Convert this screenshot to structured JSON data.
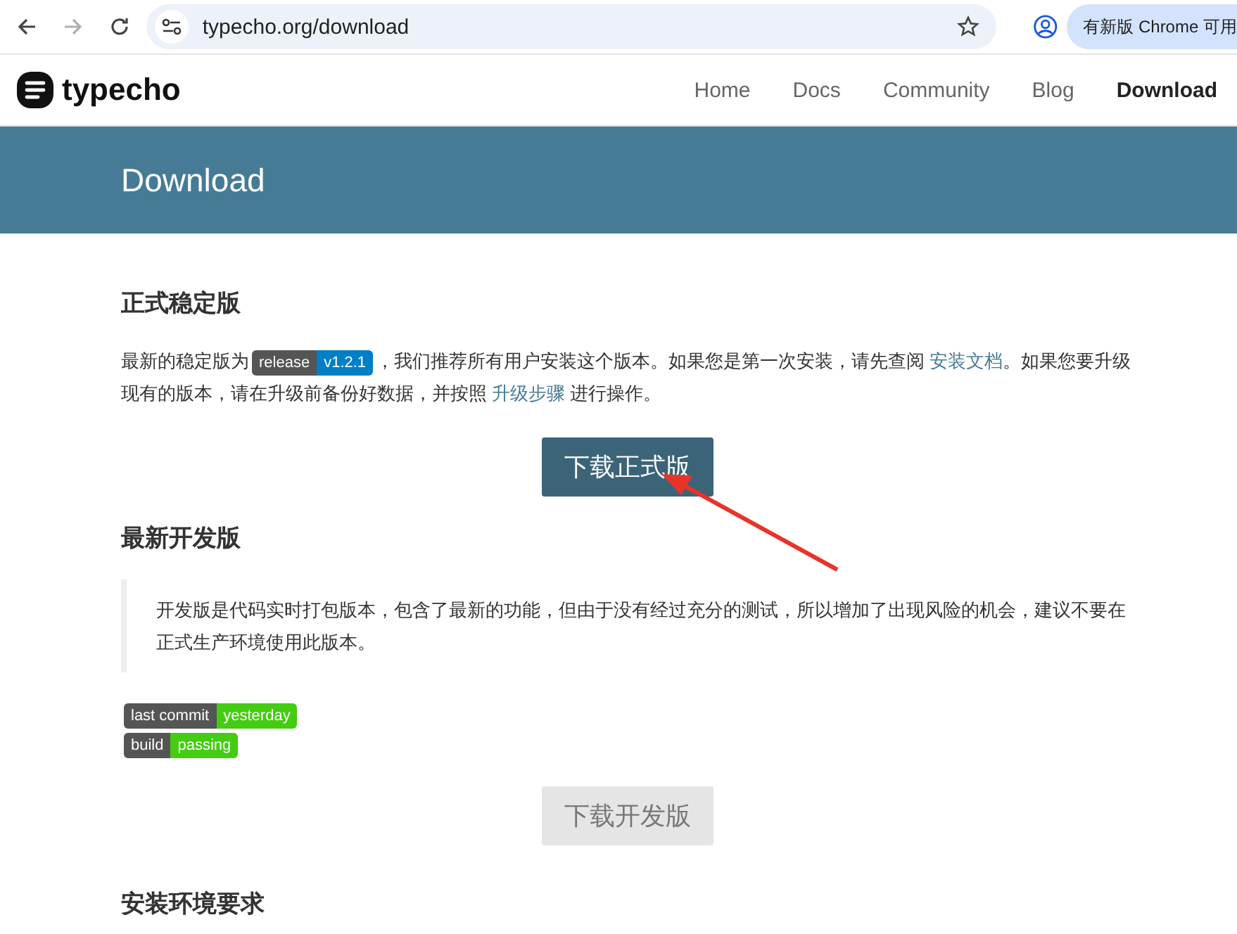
{
  "browser": {
    "url": "typecho.org/download",
    "update_chip": "有新版 Chrome 可用"
  },
  "header": {
    "logo": "typecho",
    "nav": [
      {
        "label": "Home",
        "selected": false
      },
      {
        "label": "Docs",
        "selected": false
      },
      {
        "label": "Community",
        "selected": false
      },
      {
        "label": "Blog",
        "selected": false
      },
      {
        "label": "Download",
        "selected": true
      }
    ]
  },
  "banner": {
    "title": "Download"
  },
  "stable": {
    "heading": "正式稳定版",
    "paragraph": [
      {
        "kind": "text",
        "text": "最新的稳定版为"
      },
      {
        "kind": "badge",
        "label": "release",
        "value": "v1.2.1",
        "color": "#007ec6"
      },
      {
        "kind": "text",
        "text": "，我们推荐所有用户安装这个版本。如果您是第一次安装，请先查阅 "
      },
      {
        "kind": "link",
        "text": "安装文档"
      },
      {
        "kind": "text",
        "text": "。如果您要升级现有的版本，请在升级前备份好数据，并按照 "
      },
      {
        "kind": "link",
        "text": "升级步骤"
      },
      {
        "kind": "text",
        "text": " 进行操作。"
      }
    ],
    "button": {
      "label": "下载正式版",
      "disabled": false
    }
  },
  "dev": {
    "heading": "最新开发版",
    "note": "开发版是代码实时打包版本，包含了最新的功能，但由于没有经过充分的测试，所以增加了出现风险的机会，建议不要在正式生产环境使用此版本。",
    "badges": [
      {
        "label": "last commit",
        "value": "yesterday",
        "color": "#44cc11"
      },
      {
        "label": "build",
        "value": "passing",
        "color": "#44cc11"
      }
    ],
    "button": {
      "label": "下载开发版",
      "disabled": true
    }
  },
  "requirements": {
    "heading": "安装环境要求"
  }
}
